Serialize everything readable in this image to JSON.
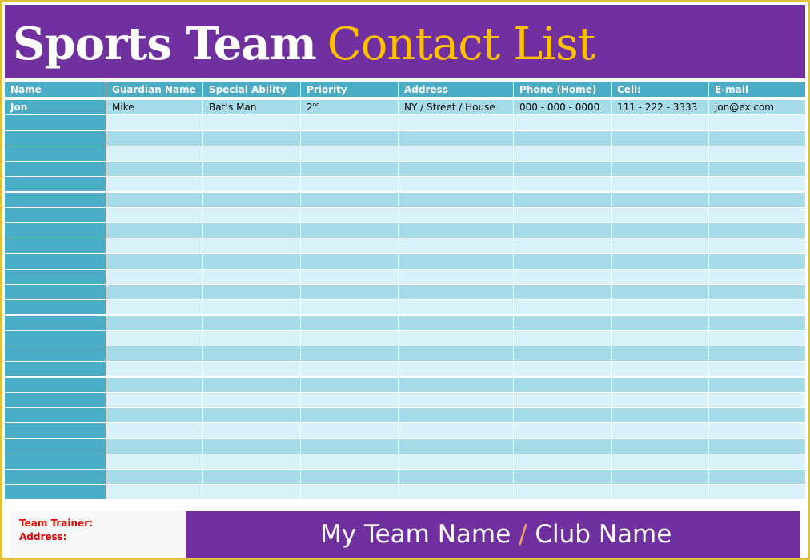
{
  "header": {
    "title_part1": "Sports Team",
    "title_part2": "Contact List"
  },
  "colors": {
    "brand_purple": "#7030a0",
    "accent_gold": "#ffc000",
    "frame_gold": "#e0c23a",
    "header_teal": "#4bacc6",
    "row_dark": "#a8dbe8",
    "row_light": "#d9f1f8",
    "label_red": "#e00000"
  },
  "table": {
    "columns": [
      "Name",
      "Guardian Name",
      "Special Ability",
      "Priority",
      "Address",
      "Phone (Home)",
      "Cell:",
      "E-mail"
    ],
    "rows": [
      {
        "name": "Jon",
        "guardian": "Mike",
        "ability": "Bat’s Man",
        "priority": "2",
        "priority_suffix": "nd",
        "address": "NY / Street / House",
        "phone": "000 - 000 - 0000",
        "cell": "111 - 222 - 3333",
        "email": "jon@ex.com"
      }
    ],
    "empty_row_count": 25
  },
  "footer": {
    "trainer_label": "Team Trainer:",
    "address_label": "Address:",
    "team_name": "My Team Name",
    "separator": "/",
    "club_name": "Club Name"
  }
}
